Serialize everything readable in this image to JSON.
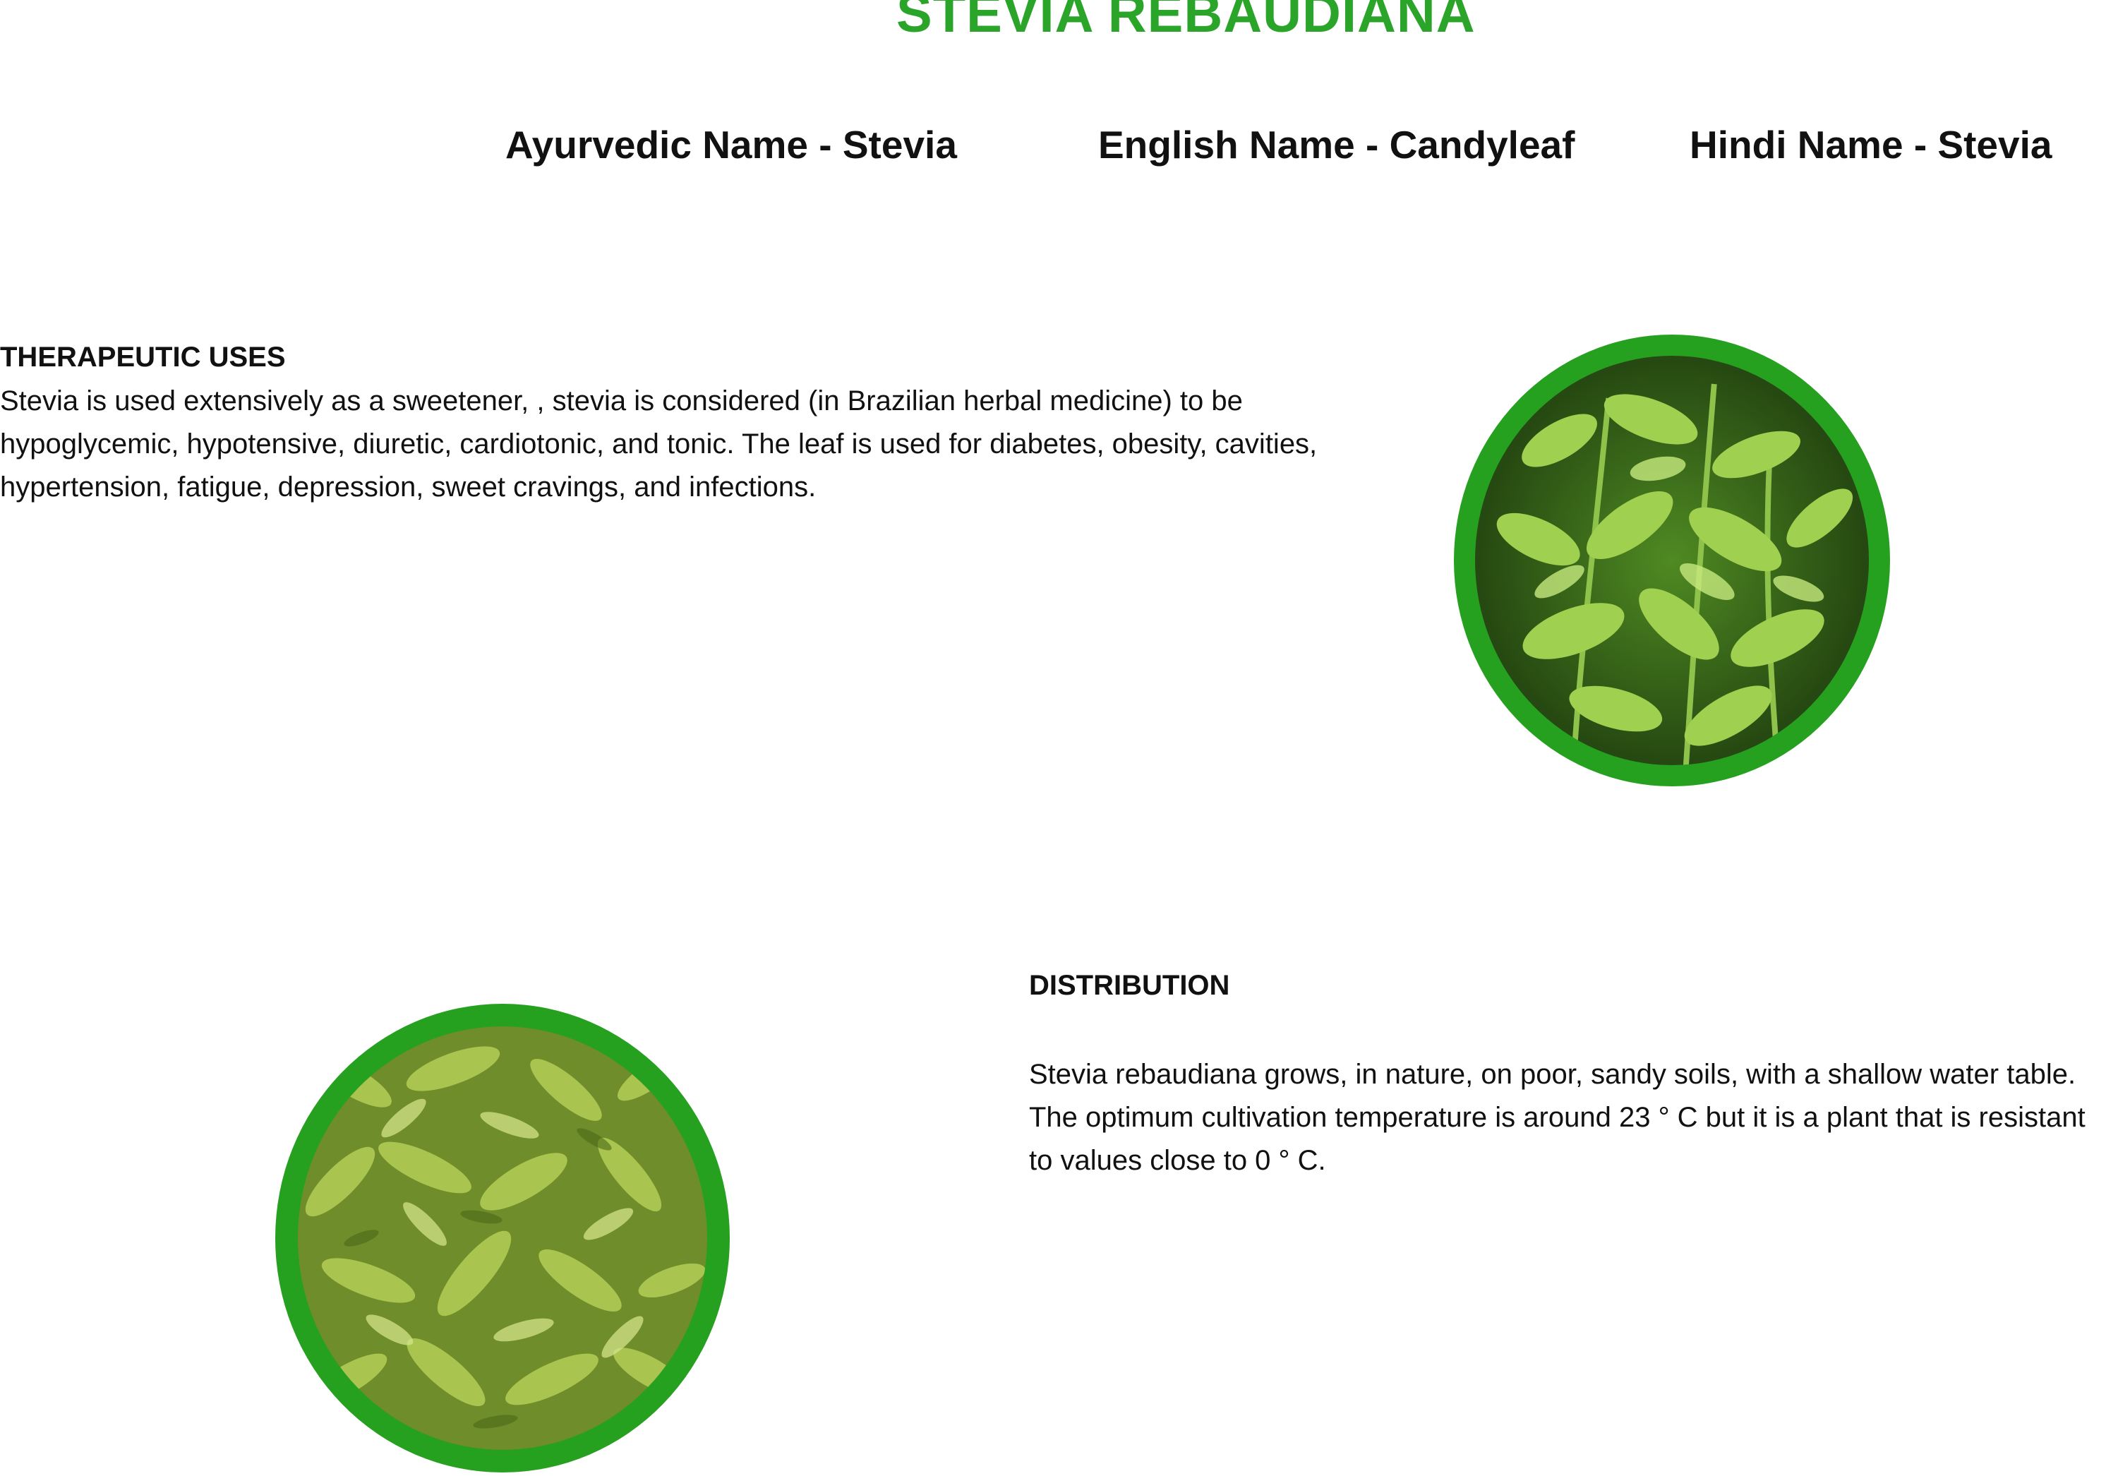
{
  "title": "STEVIA REBAUDIANA",
  "names": {
    "ayurvedic": "Ayurvedic Name -  Stevia",
    "english": "English Name  -  Candyleaf",
    "hindi": "Hindi Name -  Stevia"
  },
  "therapeutic": {
    "heading": "THERAPEUTIC USES",
    "body": "Stevia is used extensively as a sweetener, , stevia is considered (in Brazilian herbal medicine) to be hypoglycemic, hypotensive, diuretic, cardiotonic, and tonic. The leaf is used for diabetes, obesity, cavities, hypertension, fatigue, depression, sweet cravings, and infections."
  },
  "distribution": {
    "heading": "DISTRIBUTION",
    "body": "Stevia rebaudiana grows, in nature, on poor, sandy soils, with a shallow water table. The optimum cultivation temperature is around 23 ° C but it is a plant that is resistant to values close to 0 ° C."
  },
  "colors": {
    "title_green": "#2aa52a",
    "frame_green": "#26a01f"
  },
  "images": {
    "top": "fresh-stevia-plant-photo",
    "bottom": "dried-stevia-leaves-photo"
  }
}
